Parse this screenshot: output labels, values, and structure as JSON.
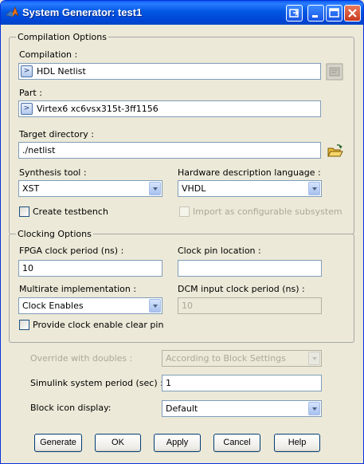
{
  "window": {
    "title": "System Generator: test1"
  },
  "compilation_options": {
    "legend": "Compilation Options",
    "compilation_label": "Compilation :",
    "compilation_value": "HDL Netlist",
    "part_label": "Part :",
    "part_value": "Virtex6  xc6vsx315t-3ff1156",
    "target_dir_label": "Target directory :",
    "target_dir_value": "./netlist",
    "synthesis_label": "Synthesis tool :",
    "synthesis_value": "XST",
    "hdl_label": "Hardware description language :",
    "hdl_value": "VHDL",
    "testbench_label": "Create testbench",
    "import_label": "Import as configurable subsystem"
  },
  "clocking_options": {
    "legend": "Clocking Options",
    "fpga_period_label": "FPGA clock period (ns) :",
    "fpga_period_value": "10",
    "clock_pin_label": "Clock pin location :",
    "clock_pin_value": "",
    "multirate_label": "Multirate implementation :",
    "multirate_value": "Clock Enables",
    "dcm_label": "DCM input clock period (ns) :",
    "dcm_value": "10",
    "clear_pin_label": "Provide clock enable clear pin"
  },
  "misc": {
    "override_label": "Override with doubles :",
    "override_value": "According to Block Settings",
    "sim_period_label": "Simulink system period (sec) :",
    "sim_period_value": "1",
    "icon_display_label": "Block icon display:",
    "icon_display_value": "Default"
  },
  "buttons": {
    "generate": "Generate",
    "ok": "OK",
    "apply": "Apply",
    "cancel": "Cancel",
    "help": "Help"
  },
  "icons": {
    "arrow_button": ">",
    "title": "matlab-logo-icon",
    "browse": "folder-open-icon",
    "settings": "settings-icon"
  }
}
